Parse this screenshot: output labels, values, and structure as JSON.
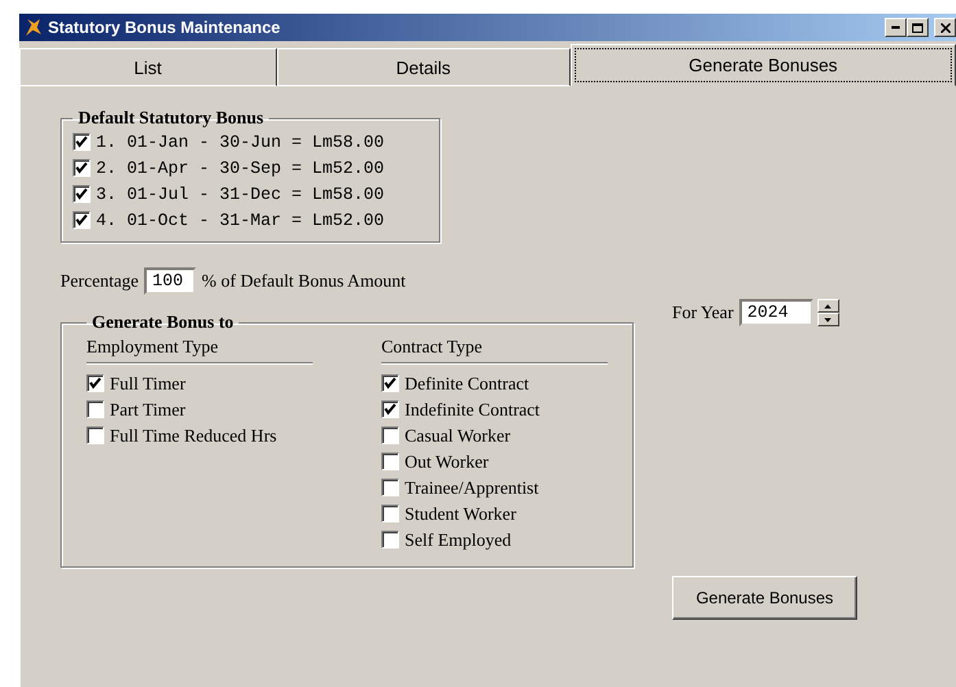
{
  "window": {
    "title": "Statutory Bonus Maintenance"
  },
  "tabs": [
    {
      "label": "List",
      "selected": false
    },
    {
      "label": "Details",
      "selected": false
    },
    {
      "label": "Generate Bonuses",
      "selected": true
    }
  ],
  "default_statutory_bonus": {
    "title": "Default Statutory Bonus",
    "items": [
      {
        "label": "1. 01-Jan - 30-Jun = Lm58.00",
        "checked": true
      },
      {
        "label": "2. 01-Apr - 30-Sep = Lm52.00",
        "checked": true
      },
      {
        "label": "3. 01-Jul - 31-Dec = Lm58.00",
        "checked": true
      },
      {
        "label": "4. 01-Oct - 31-Mar = Lm52.00",
        "checked": true
      }
    ]
  },
  "percentage": {
    "label": "Percentage",
    "value": "100",
    "suffix": "% of Default Bonus Amount"
  },
  "generate_bonus_to": {
    "title": "Generate Bonus to",
    "groups": [
      {
        "title": "Employment Type",
        "items": [
          {
            "label": "Full Timer",
            "checked": true
          },
          {
            "label": "Part Timer",
            "checked": false
          },
          {
            "label": "Full Time Reduced Hrs",
            "checked": false
          }
        ]
      },
      {
        "title": "Contract Type",
        "items": [
          {
            "label": "Definite Contract",
            "checked": true
          },
          {
            "label": "Indefinite Contract",
            "checked": true
          },
          {
            "label": "Casual Worker",
            "checked": false
          },
          {
            "label": "Out Worker",
            "checked": false
          },
          {
            "label": "Trainee/Apprentist",
            "checked": false
          },
          {
            "label": "Student Worker",
            "checked": false
          },
          {
            "label": "Self Employed",
            "checked": false
          }
        ]
      }
    ]
  },
  "for_year": {
    "label": "For Year",
    "value": "2024"
  },
  "generate_button": "Generate Bonuses"
}
